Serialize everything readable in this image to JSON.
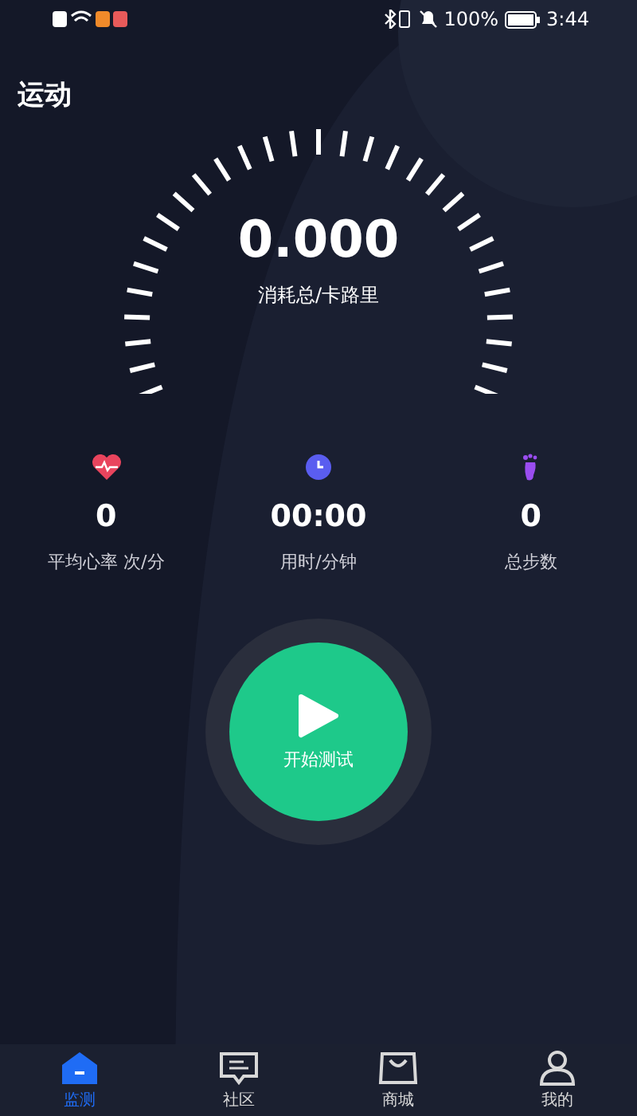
{
  "status_bar": {
    "battery": "100%",
    "time": "3:44"
  },
  "title": "运动",
  "gauge": {
    "value": "0.000",
    "unit": "消耗总/卡路里"
  },
  "stats": [
    {
      "kind": "heart",
      "value": "0",
      "label": "平均心率 次/分"
    },
    {
      "kind": "clock",
      "value": "00:00",
      "label": "用时/分钟"
    },
    {
      "kind": "foot",
      "value": "0",
      "label": "总步数"
    }
  ],
  "start_button": {
    "label": "开始测试"
  },
  "tabs": [
    {
      "kind": "home",
      "label": "监测",
      "selected": true
    },
    {
      "kind": "chat",
      "label": "社区",
      "selected": false
    },
    {
      "kind": "bag",
      "label": "商城",
      "selected": false
    },
    {
      "kind": "user",
      "label": "我的",
      "selected": false
    }
  ]
}
